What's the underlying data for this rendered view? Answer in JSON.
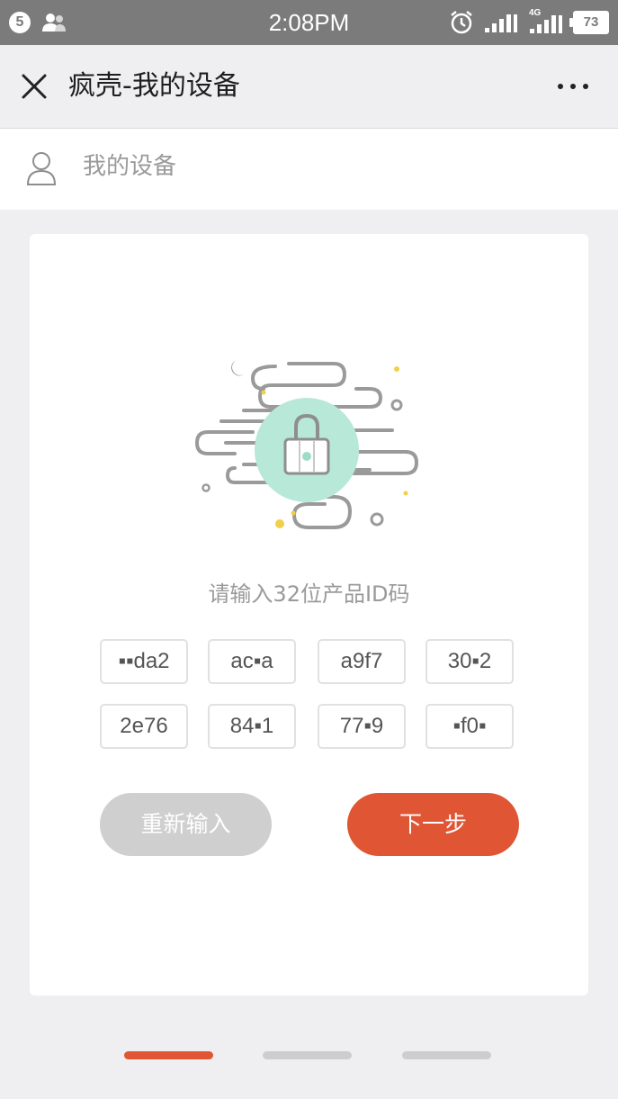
{
  "status_bar": {
    "badge": "5",
    "time": "2:08PM",
    "network": "4G",
    "battery": "73",
    "icons": [
      "people-icon",
      "alarm-icon",
      "signal-icon",
      "signal-4g-icon",
      "battery-icon"
    ]
  },
  "header": {
    "title": "疯壳-我的设备",
    "close_icon": "close-icon",
    "more_icon": "more-icon"
  },
  "account": {
    "label": "我的设备",
    "icon": "person-icon"
  },
  "card": {
    "illustration_icon": "lock-cloud-illustration",
    "prompt": "请输入32位产品ID码",
    "codes": [
      "▪▪da2",
      "ac▪a",
      "a9f7",
      "30▪2",
      "2e76",
      "84▪1",
      "77▪9",
      "▪f0▪"
    ],
    "reset_label": "重新输入",
    "next_label": "下一步"
  },
  "pager": {
    "count": 3,
    "active_index": 0
  },
  "colors": {
    "accent": "#e05533",
    "disabled": "#cfcfcf",
    "statusbar": "#7b7b7b",
    "lock_circle": "#b8e8d8"
  }
}
